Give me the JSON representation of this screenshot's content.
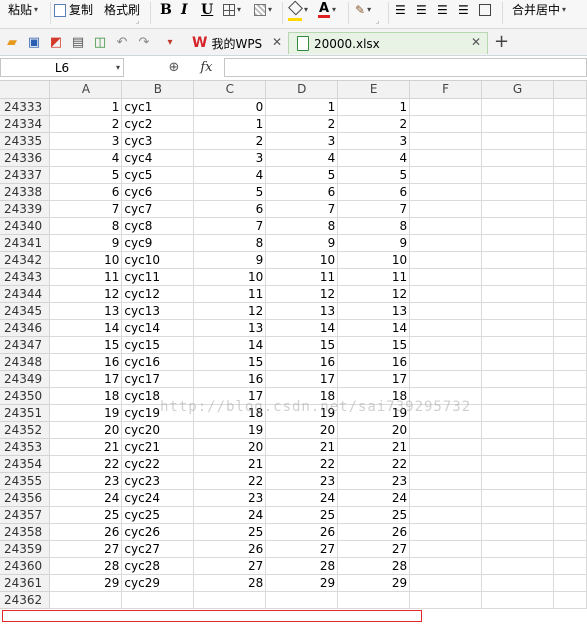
{
  "ribbon": {
    "paste_label": "粘贴",
    "copy_label": "复制",
    "format_painter_label": "格式刷",
    "bold_glyph": "B",
    "italic_glyph": "I",
    "underline_glyph": "U",
    "merge_center_label": "合并居中"
  },
  "tabs": [
    {
      "label": "我的WPS",
      "active": false
    },
    {
      "label": "20000.xlsx",
      "active": true
    }
  ],
  "formula_bar": {
    "cell_ref": "L6",
    "fx_label": "fx",
    "formula_value": ""
  },
  "grid": {
    "columns": [
      "A",
      "B",
      "C",
      "D",
      "E",
      "F",
      "G"
    ],
    "rows": [
      {
        "row": "24333",
        "a": "1",
        "b": "cyc1",
        "c": "0",
        "d": "1",
        "e": "1"
      },
      {
        "row": "24334",
        "a": "2",
        "b": "cyc2",
        "c": "1",
        "d": "2",
        "e": "2"
      },
      {
        "row": "24335",
        "a": "3",
        "b": "cyc3",
        "c": "2",
        "d": "3",
        "e": "3"
      },
      {
        "row": "24336",
        "a": "4",
        "b": "cyc4",
        "c": "3",
        "d": "4",
        "e": "4"
      },
      {
        "row": "24337",
        "a": "5",
        "b": "cyc5",
        "c": "4",
        "d": "5",
        "e": "5"
      },
      {
        "row": "24338",
        "a": "6",
        "b": "cyc6",
        "c": "5",
        "d": "6",
        "e": "6"
      },
      {
        "row": "24339",
        "a": "7",
        "b": "cyc7",
        "c": "6",
        "d": "7",
        "e": "7"
      },
      {
        "row": "24340",
        "a": "8",
        "b": "cyc8",
        "c": "7",
        "d": "8",
        "e": "8"
      },
      {
        "row": "24341",
        "a": "9",
        "b": "cyc9",
        "c": "8",
        "d": "9",
        "e": "9"
      },
      {
        "row": "24342",
        "a": "10",
        "b": "cyc10",
        "c": "9",
        "d": "10",
        "e": "10"
      },
      {
        "row": "24343",
        "a": "11",
        "b": "cyc11",
        "c": "10",
        "d": "11",
        "e": "11"
      },
      {
        "row": "24344",
        "a": "12",
        "b": "cyc12",
        "c": "11",
        "d": "12",
        "e": "12"
      },
      {
        "row": "24345",
        "a": "13",
        "b": "cyc13",
        "c": "12",
        "d": "13",
        "e": "13"
      },
      {
        "row": "24346",
        "a": "14",
        "b": "cyc14",
        "c": "13",
        "d": "14",
        "e": "14"
      },
      {
        "row": "24347",
        "a": "15",
        "b": "cyc15",
        "c": "14",
        "d": "15",
        "e": "15"
      },
      {
        "row": "24348",
        "a": "16",
        "b": "cyc16",
        "c": "15",
        "d": "16",
        "e": "16"
      },
      {
        "row": "24349",
        "a": "17",
        "b": "cyc17",
        "c": "16",
        "d": "17",
        "e": "17"
      },
      {
        "row": "24350",
        "a": "18",
        "b": "cyc18",
        "c": "17",
        "d": "18",
        "e": "18"
      },
      {
        "row": "24351",
        "a": "19",
        "b": "cyc19",
        "c": "18",
        "d": "19",
        "e": "19"
      },
      {
        "row": "24352",
        "a": "20",
        "b": "cyc20",
        "c": "19",
        "d": "20",
        "e": "20"
      },
      {
        "row": "24353",
        "a": "21",
        "b": "cyc21",
        "c": "20",
        "d": "21",
        "e": "21"
      },
      {
        "row": "24354",
        "a": "22",
        "b": "cyc22",
        "c": "21",
        "d": "22",
        "e": "22"
      },
      {
        "row": "24355",
        "a": "23",
        "b": "cyc23",
        "c": "22",
        "d": "23",
        "e": "23"
      },
      {
        "row": "24356",
        "a": "24",
        "b": "cyc24",
        "c": "23",
        "d": "24",
        "e": "24"
      },
      {
        "row": "24357",
        "a": "25",
        "b": "cyc25",
        "c": "24",
        "d": "25",
        "e": "25"
      },
      {
        "row": "24358",
        "a": "26",
        "b": "cyc26",
        "c": "25",
        "d": "26",
        "e": "26"
      },
      {
        "row": "24359",
        "a": "27",
        "b": "cyc27",
        "c": "26",
        "d": "27",
        "e": "27"
      },
      {
        "row": "24360",
        "a": "28",
        "b": "cyc28",
        "c": "27",
        "d": "28",
        "e": "28"
      },
      {
        "row": "24361",
        "a": "29",
        "b": "cyc29",
        "c": "28",
        "d": "29",
        "e": "29"
      },
      {
        "row": "24362",
        "a": "",
        "b": "",
        "c": "",
        "d": "",
        "e": ""
      }
    ]
  },
  "watermark": "http://blog.csdn.net/sai739295732",
  "colors": {
    "highlight_border": "#e02b2b",
    "active_tab_bg": "#e8f3e6",
    "wps_logo": "#d7262b"
  }
}
